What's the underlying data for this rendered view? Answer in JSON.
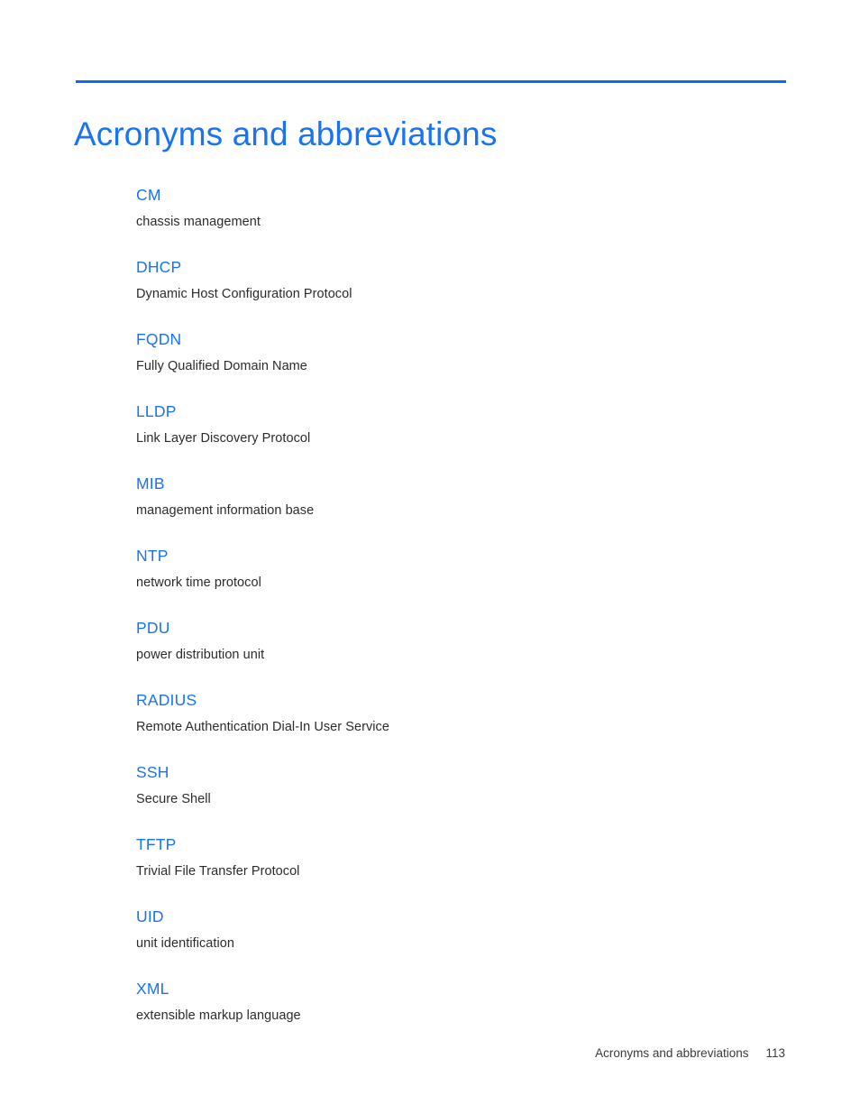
{
  "document": {
    "title": "Acronyms and abbreviations",
    "accent_color": "#1a73f0",
    "rule_color": "#0a6cf1",
    "body_text_color": "#2b2b2b",
    "background_color": "#ffffff"
  },
  "glossary": {
    "entries": [
      {
        "term": "CM",
        "definition": "chassis management"
      },
      {
        "term": "DHCP",
        "definition": "Dynamic Host Configuration Protocol"
      },
      {
        "term": "FQDN",
        "definition": "Fully Qualified Domain Name"
      },
      {
        "term": "LLDP",
        "definition": "Link Layer Discovery Protocol"
      },
      {
        "term": "MIB",
        "definition": "management information base"
      },
      {
        "term": "NTP",
        "definition": "network time protocol"
      },
      {
        "term": "PDU",
        "definition": "power distribution unit"
      },
      {
        "term": "RADIUS",
        "definition": "Remote Authentication Dial-In User Service"
      },
      {
        "term": "SSH",
        "definition": "Secure Shell"
      },
      {
        "term": "TFTP",
        "definition": "Trivial File Transfer Protocol"
      },
      {
        "term": "UID",
        "definition": "unit identification"
      },
      {
        "term": "XML",
        "definition": "extensible markup language"
      }
    ]
  },
  "footer": {
    "label": "Acronyms and abbreviations",
    "page_number": "113"
  }
}
